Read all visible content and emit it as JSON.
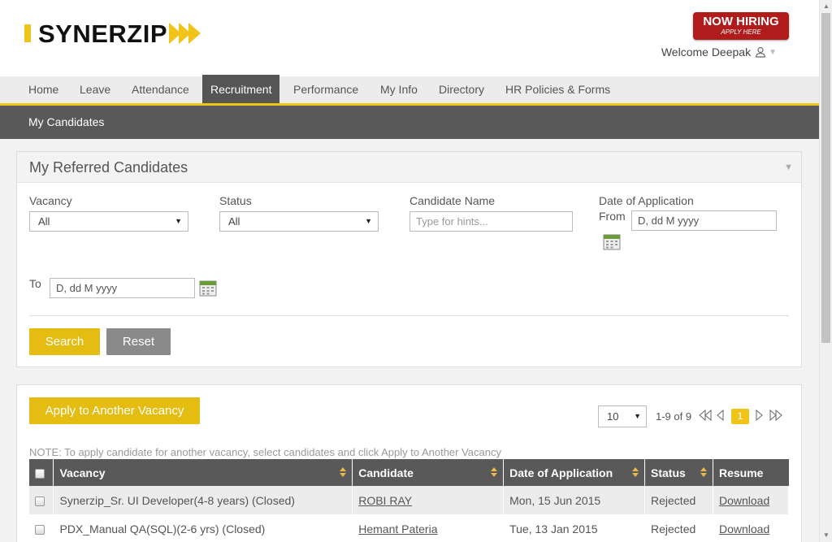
{
  "header": {
    "logo_text": "SYNERZIP",
    "hiring_big": "NOW HIRING",
    "hiring_small": "APPLY HERE",
    "welcome": "Welcome Deepak"
  },
  "nav": {
    "items": [
      "Home",
      "Leave",
      "Attendance",
      "Recruitment",
      "Performance",
      "My Info",
      "Directory",
      "HR Policies & Forms"
    ],
    "active": "Recruitment"
  },
  "subnav": {
    "item": "My Candidates"
  },
  "filter": {
    "title": "My Referred Candidates",
    "vacancy_label": "Vacancy",
    "vacancy_value": "All",
    "status_label": "Status",
    "status_value": "All",
    "candidate_label": "Candidate Name",
    "candidate_placeholder": "Type for hints...",
    "date_label": "Date of Application",
    "from_label": "From",
    "from_value": "D, dd M yyyy",
    "to_label": "To",
    "to_value": "D, dd M yyyy",
    "search_label": "Search",
    "reset_label": "Reset"
  },
  "results": {
    "apply_label": "Apply to Another Vacancy",
    "page_size": "10",
    "count_text": "1-9 of 9",
    "current_page": "1",
    "note": "NOTE: To apply candidate for another vacancy, select candidates and click Apply to Another Vacancy",
    "columns": [
      "Vacancy",
      "Candidate",
      "Date of Application",
      "Status",
      "Resume"
    ],
    "rows": [
      {
        "vacancy": "Synerzip_Sr. UI Developer(4-8 years) (Closed)",
        "candidate": "ROBI RAY",
        "date": "Mon, 15 Jun 2015",
        "status": "Rejected",
        "resume": "Download"
      },
      {
        "vacancy": "PDX_Manual QA(SQL)(2-6 yrs) (Closed)",
        "candidate": "Hemant Pateria",
        "date": "Tue, 13 Jan 2015",
        "status": "Rejected",
        "resume": "Download"
      }
    ]
  },
  "colors": {
    "accent_yellow": "#f0c419",
    "nav_dark": "#595959",
    "hiring_red": "#b01c1c"
  }
}
